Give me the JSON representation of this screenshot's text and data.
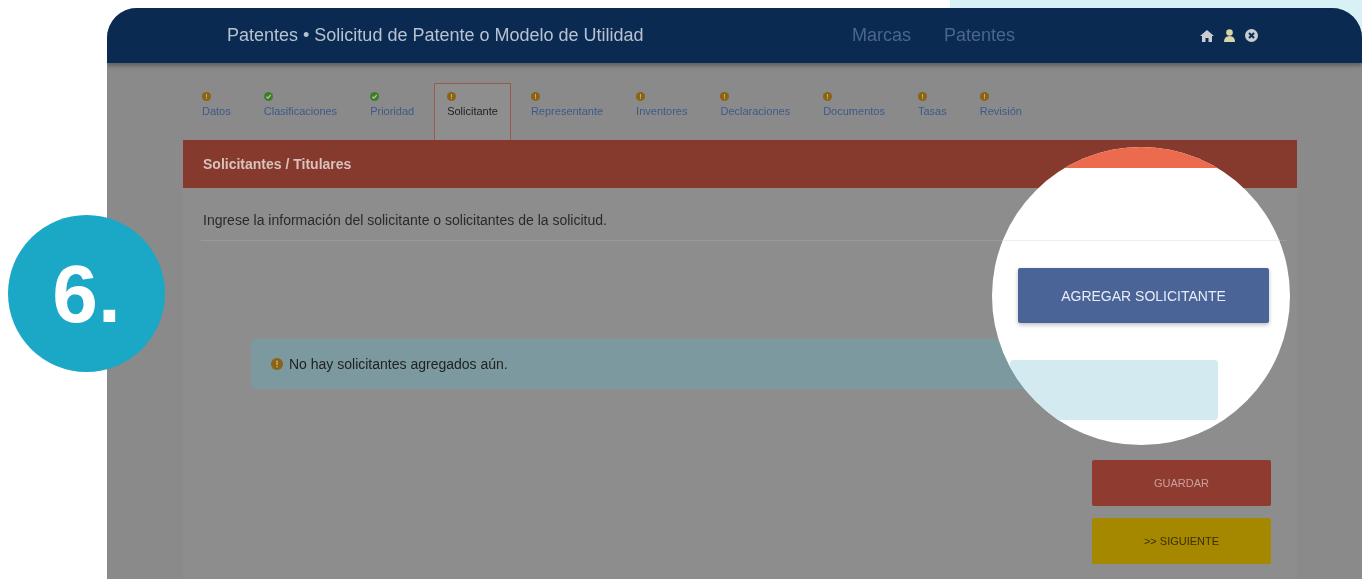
{
  "step_badge": {
    "label": "6."
  },
  "top_bar": {
    "title": "Patentes • Solicitud de Patente o Modelo de Utilidad",
    "nav": [
      {
        "label": "Marcas"
      },
      {
        "label": "Patentes"
      }
    ]
  },
  "tabs": [
    {
      "label": "Datos",
      "complete": false,
      "selected": false
    },
    {
      "label": "Clasificaciones",
      "complete": true,
      "selected": false
    },
    {
      "label": "Prioridad",
      "complete": true,
      "selected": false
    },
    {
      "label": "Solicitante",
      "complete": false,
      "selected": true
    },
    {
      "label": "Representante",
      "complete": false,
      "selected": false
    },
    {
      "label": "Inventores",
      "complete": false,
      "selected": false
    },
    {
      "label": "Declaraciones",
      "complete": false,
      "selected": false
    },
    {
      "label": "Documentos",
      "complete": false,
      "selected": false
    },
    {
      "label": "Tasas",
      "complete": false,
      "selected": false
    },
    {
      "label": "Revisión",
      "complete": false,
      "selected": false
    }
  ],
  "panel": {
    "title": "Solicitantes / Titulares",
    "intro": "Ingrese la información del solicitante o solicitantes de la solicitud.",
    "alert": "No hay solicitantes agregados aún."
  },
  "buttons": [
    {
      "label": "GUARDAR",
      "kind": "save"
    },
    {
      "label": ">> SIGUIENTE",
      "kind": "next"
    }
  ],
  "magnifier": {
    "button_label": "AGREGAR SOLICITANTE"
  }
}
